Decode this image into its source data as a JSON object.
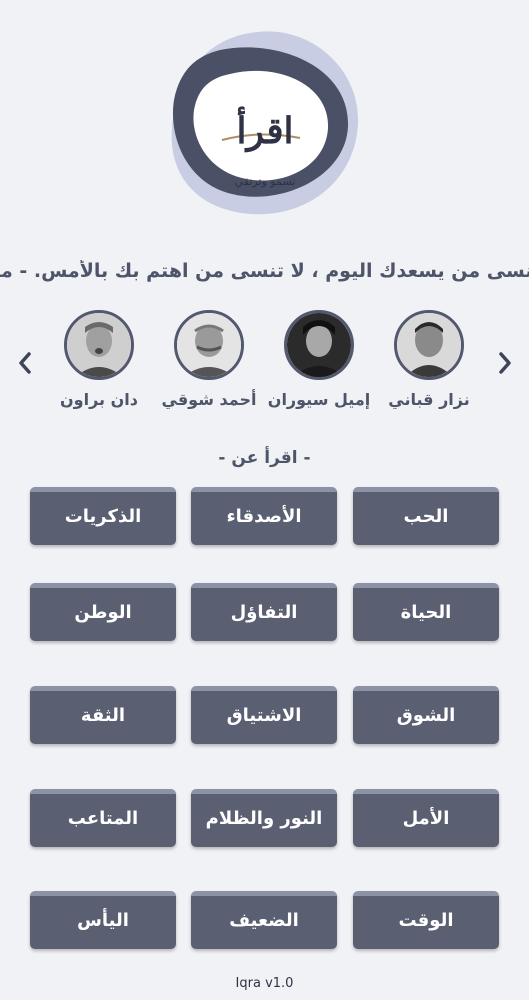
{
  "logo": {
    "main_text": "اقرأ",
    "tagline": "تسمو وترتقي"
  },
  "quote": {
    "text": "لا تنسى من يسعدك اليوم ، لا تنسى من اهتم بك بالأمس. - مارك"
  },
  "authors": [
    {
      "name": "نزار قباني",
      "photo_icon": "portrait-icon"
    },
    {
      "name": "إميل سيوران",
      "photo_icon": "portrait-icon"
    },
    {
      "name": "أحمد شوقي",
      "photo_icon": "portrait-icon"
    },
    {
      "name": "دان براون",
      "photo_icon": "portrait-icon"
    }
  ],
  "topics_heading": "- اقرأ عن -",
  "topics": [
    [
      "الحب",
      "الأصدقاء",
      "الذكريات"
    ],
    [
      "الحياة",
      "التفاؤل",
      "الوطن"
    ],
    [
      "الشوق",
      "الاشتياق",
      "الثقة"
    ],
    [
      "الأمل",
      "النور والظلام",
      "المتاعب"
    ],
    [
      "الوقت",
      "الضعيف",
      "اليأس"
    ]
  ],
  "footer": {
    "version": "Iqra v1.0"
  },
  "colors": {
    "background": "#f1f2f6",
    "button": "#5a5f72",
    "button_top": "#8d93a6",
    "accent_dark": "#3f4559"
  }
}
